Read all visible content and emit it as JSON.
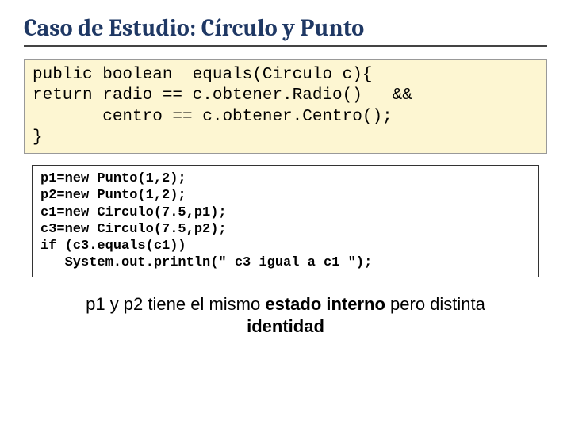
{
  "title": "Caso de Estudio: Círculo y Punto",
  "code1": {
    "l1": "public boolean  equals(Circulo c){",
    "l2": "return radio == c.obtener.Radio()   &&",
    "l3": "       centro == c.obtener.Centro();",
    "l4": "}"
  },
  "code2": {
    "l1": "p1=new Punto(1,2);",
    "l2": "p2=new Punto(1,2);",
    "l3": "c1=new Circulo(7.5,p1);",
    "l4": "c3=new Circulo(7.5,p2);",
    "l5": "if (c3.equals(c1))",
    "l6": "   System.out.println(\" c3 igual a c1 \");"
  },
  "caption": {
    "t1": "p1 y p2 tiene el mismo ",
    "b1": "estado interno",
    "t2": " pero distinta ",
    "b2": "identidad"
  }
}
